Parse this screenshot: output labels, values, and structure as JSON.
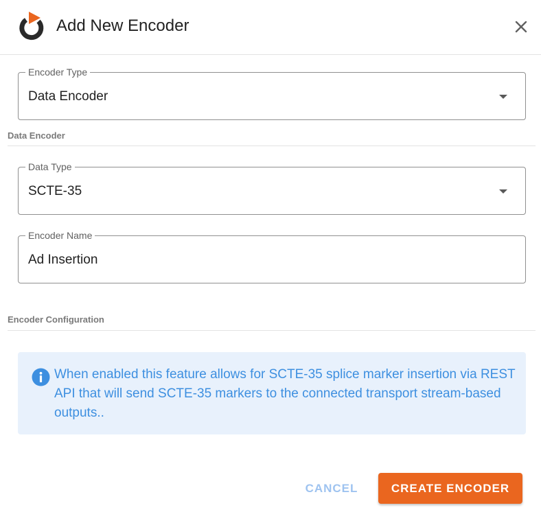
{
  "dialog": {
    "title": "Add New Encoder",
    "logo_icon": "brand-logo-icon",
    "close_icon": "close-icon"
  },
  "fields": {
    "encoder_type": {
      "label": "Encoder Type",
      "value": "Data Encoder"
    },
    "data_type": {
      "label": "Data Type",
      "value": "SCTE-35"
    },
    "encoder_name": {
      "label": "Encoder Name",
      "value": "Ad Insertion"
    }
  },
  "sections": {
    "data_encoder": "Data Encoder",
    "encoder_configuration": "Encoder Configuration"
  },
  "info": {
    "icon": "info-icon",
    "text": "When enabled this feature allows for SCTE-35 splice marker insertion via REST API that will send SCTE-35 markers to the connected transport stream-based outputs.."
  },
  "actions": {
    "cancel_label": "CANCEL",
    "create_label": "CREATE ENCODER"
  },
  "colors": {
    "accent_orange": "#ea661f",
    "info_blue": "#3d8fe0",
    "info_background": "#e8f1fc",
    "cancel_text": "#9ec3f0"
  }
}
